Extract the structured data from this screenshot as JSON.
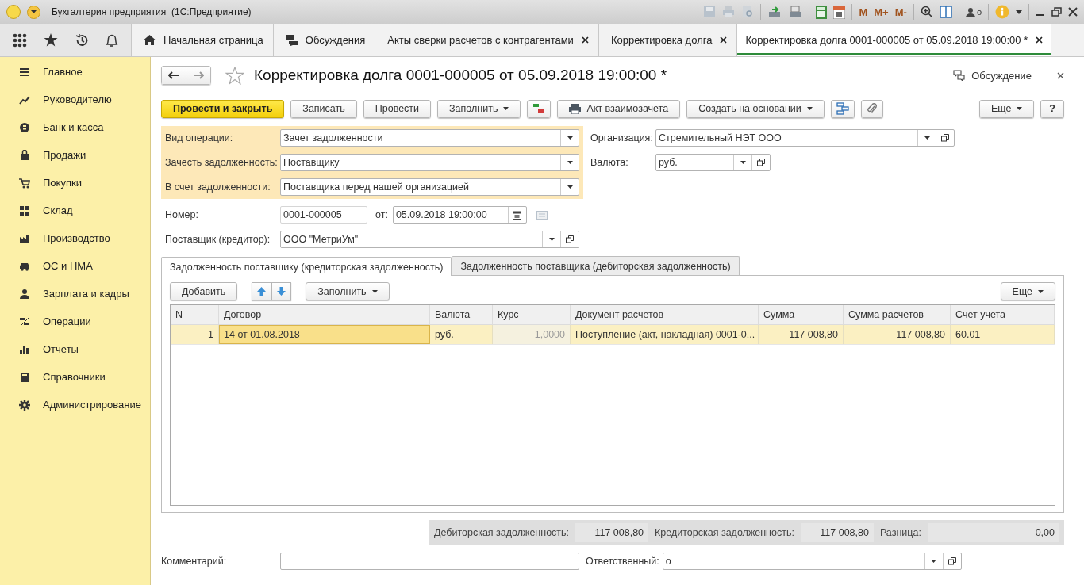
{
  "window": {
    "title": "Бухгалтерия предприятия  (1С:Предприятие)",
    "memory_buttons": [
      "M",
      "M+",
      "M-"
    ],
    "user_count": "o"
  },
  "nav_tabs": [
    {
      "label": "Начальная страница",
      "kind": "home",
      "selected": false
    },
    {
      "label": "Обсуждения",
      "kind": "chat",
      "selected": false
    },
    {
      "label": "Акты сверки расчетов с контрагентами",
      "kind": "closable",
      "selected": false
    },
    {
      "label": "Корректировка долга",
      "kind": "closable",
      "selected": false
    },
    {
      "label": "Корректировка долга 0001-000005 от 05.09.2018 19:00:00 *",
      "kind": "closable",
      "selected": true
    }
  ],
  "sidebar": {
    "items": [
      {
        "label": "Главное"
      },
      {
        "label": "Руководителю"
      },
      {
        "label": "Банк и касса"
      },
      {
        "label": "Продажи"
      },
      {
        "label": "Покупки"
      },
      {
        "label": "Склад"
      },
      {
        "label": "Производство"
      },
      {
        "label": "ОС и НМА"
      },
      {
        "label": "Зарплата и кадры"
      },
      {
        "label": "Операции"
      },
      {
        "label": "Отчеты"
      },
      {
        "label": "Справочники"
      },
      {
        "label": "Администрирование"
      }
    ]
  },
  "form": {
    "title": "Корректировка долга 0001-000005 от 05.09.2018 19:00:00 *",
    "discussion": "Обсуждение",
    "buttons": [
      {
        "label": "Провести и закрыть",
        "kind": "primary"
      },
      {
        "label": "Записать",
        "kind": "plain"
      },
      {
        "label": "Провести",
        "kind": "plain"
      },
      {
        "label": "Заполнить",
        "kind": "dropdown"
      },
      {
        "label": "Акт взаимозачета",
        "kind": "print"
      },
      {
        "label": "Создать на основании",
        "kind": "dropdown"
      }
    ],
    "more_button": "Еще",
    "help_button": "?",
    "operation_fields": [
      {
        "label": "Вид операции:",
        "value": "Зачет задолженности"
      },
      {
        "label": "Зачесть задолженность:",
        "value": "Поставщику"
      },
      {
        "label": "В счет задолженности:",
        "value": "Поставщика перед нашей организацией"
      }
    ],
    "organization": {
      "label": "Организация:",
      "value": "Стремительный НЭТ ООО"
    },
    "currency": {
      "label": "Валюта:",
      "value": "руб."
    },
    "number": {
      "label": "Номер:",
      "value": "0001-000005"
    },
    "date": {
      "label": "от:",
      "value": "05.09.2018 19:00:00"
    },
    "supplier": {
      "label": "Поставщик (кредитор):",
      "value": "ООО \"МетриУм\""
    },
    "inner_tabs": [
      {
        "label": "Задолженность поставщику (кредиторская задолженность)",
        "selected": true
      },
      {
        "label": "Задолженность поставщика (дебиторская задолженность)",
        "selected": false
      }
    ],
    "table_toolbar": {
      "add": "Добавить",
      "fill": "Заполнить",
      "more": "Еще"
    },
    "table": {
      "columns": [
        {
          "label": "N",
          "kind": "number"
        },
        {
          "label": "Договор",
          "kind": "text"
        },
        {
          "label": "Валюта",
          "kind": "text"
        },
        {
          "label": "Курс",
          "kind": "readonly"
        },
        {
          "label": "Документ расчетов",
          "kind": "text"
        },
        {
          "label": "Сумма",
          "kind": "number"
        },
        {
          "label": "Сумма расчетов",
          "kind": "number"
        },
        {
          "label": "Счет учета",
          "kind": "text"
        }
      ],
      "rows": [
        {
          "selected": true,
          "cells": [
            {
              "text": "1",
              "focused": false
            },
            {
              "text": "14 от 01.08.2018",
              "focused": true
            },
            {
              "text": "руб.",
              "focused": false
            },
            {
              "text": "1,0000",
              "focused": false
            },
            {
              "text": "Поступление (акт, накладная) 0001-0...",
              "focused": false
            },
            {
              "text": "117 008,80",
              "focused": false
            },
            {
              "text": "117 008,80",
              "focused": false
            },
            {
              "text": "60.01",
              "focused": false
            }
          ]
        }
      ]
    },
    "totals": [
      {
        "label": "Дебиторская задолженность:",
        "value": "117 008,80"
      },
      {
        "label": "Кредиторская задолженность:",
        "value": "117 008,80"
      },
      {
        "label": "Разница:",
        "value": "0,00"
      }
    ],
    "comment": {
      "label": "Комментарий:"
    },
    "responsible": {
      "label": "Ответственный:",
      "value": "o"
    }
  }
}
